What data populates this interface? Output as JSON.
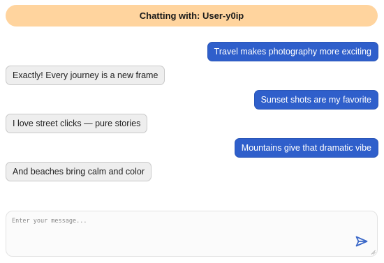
{
  "header": {
    "title": "Chatting with: User-y0ip"
  },
  "messages": [
    {
      "direction": "sent",
      "text": "Travel makes photography more exciting"
    },
    {
      "direction": "received",
      "text": "Exactly! Every journey is a new frame"
    },
    {
      "direction": "sent",
      "text": "Sunset shots are my favorite"
    },
    {
      "direction": "received",
      "text": "I love street clicks — pure stories"
    },
    {
      "direction": "sent",
      "text": "Mountains give that dramatic vibe"
    },
    {
      "direction": "received",
      "text": "And beaches bring calm and color"
    }
  ],
  "composer": {
    "placeholder": "Enter your message...",
    "value": "",
    "send_icon": "send-icon"
  },
  "colors": {
    "header_bg": "#ffd49e",
    "sent_bg": "#2f5fcb",
    "received_bg": "#eeeeee",
    "send_icon": "#3b68c8"
  }
}
